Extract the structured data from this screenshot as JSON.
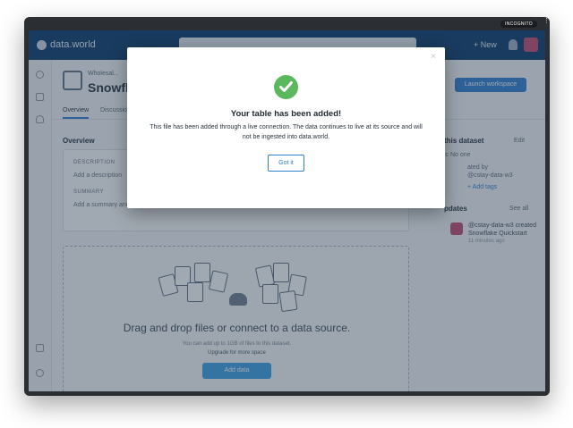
{
  "browser": {
    "incognito_label": "INCOGNITO"
  },
  "header": {
    "logo_text": "data.world",
    "new_label": "+ New"
  },
  "dataset": {
    "owner": "Wholesal...",
    "title": "Snowfla",
    "launch_label": "Launch workspace",
    "tabs": [
      {
        "label": "Overview"
      },
      {
        "label": "Discussion"
      }
    ]
  },
  "overview": {
    "heading": "Overview",
    "description_label": "DESCRIPTION",
    "description_add": "Add a description",
    "summary_label": "SUMMARY",
    "summary_add": "Add a summary and..."
  },
  "dropzone": {
    "text": "Drag and drop files or connect to a data source.",
    "sub": "You can add up to 1GB of files to this dataset.",
    "sub2": "Upgrade for more space",
    "add_files": "Add data"
  },
  "sidebar": {
    "about_heading": "this dataset",
    "about_edit": "Edit",
    "line1": "ic  No one",
    "line2": "ated by",
    "line3": "@cstay-data-w3",
    "tags": "+ Add tags",
    "updates_heading": "pdates",
    "updates_all": "See all",
    "update_text": "@cstay-data-w3 created Snowflake Quickstart",
    "update_time": "11 minutes ago"
  },
  "modal": {
    "close_glyph": "×",
    "title": "Your table has been added!",
    "body": "This file has been added through a live connection. The data continues to live at its source and will not be ingested into data.world.",
    "button": "Got it",
    "check_color": "#5cb85c"
  }
}
